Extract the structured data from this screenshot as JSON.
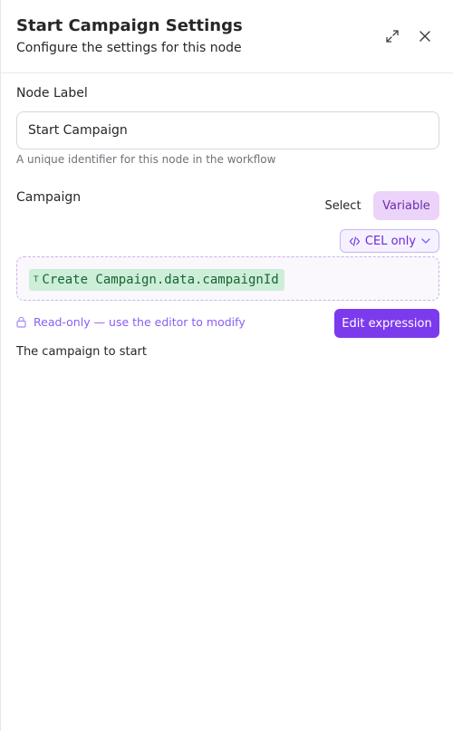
{
  "header": {
    "title": "Start Campaign Settings",
    "subtitle": "Configure the settings for this node",
    "expand_icon": "expand-icon",
    "close_icon": "close-icon"
  },
  "node_label": {
    "label": "Node Label",
    "value": "Start Campaign",
    "helper": "A unique identifier for this node in the workflow"
  },
  "campaign": {
    "label": "Campaign",
    "modes": {
      "select": "Select",
      "variable": "Variable",
      "active": "Variable"
    },
    "cel_button": "CEL only",
    "expression": {
      "type_marker": "T",
      "text": "Create Campaign.data.campaignId"
    },
    "readonly_text": "Read-only — use the editor to modify",
    "edit_button": "Edit expression",
    "description": "The campaign to start"
  },
  "colors": {
    "accent": "#7c3aed",
    "variable_active_bg": "#ecd3fa",
    "chip_bg": "#cdeed9",
    "chip_text": "#166534"
  }
}
